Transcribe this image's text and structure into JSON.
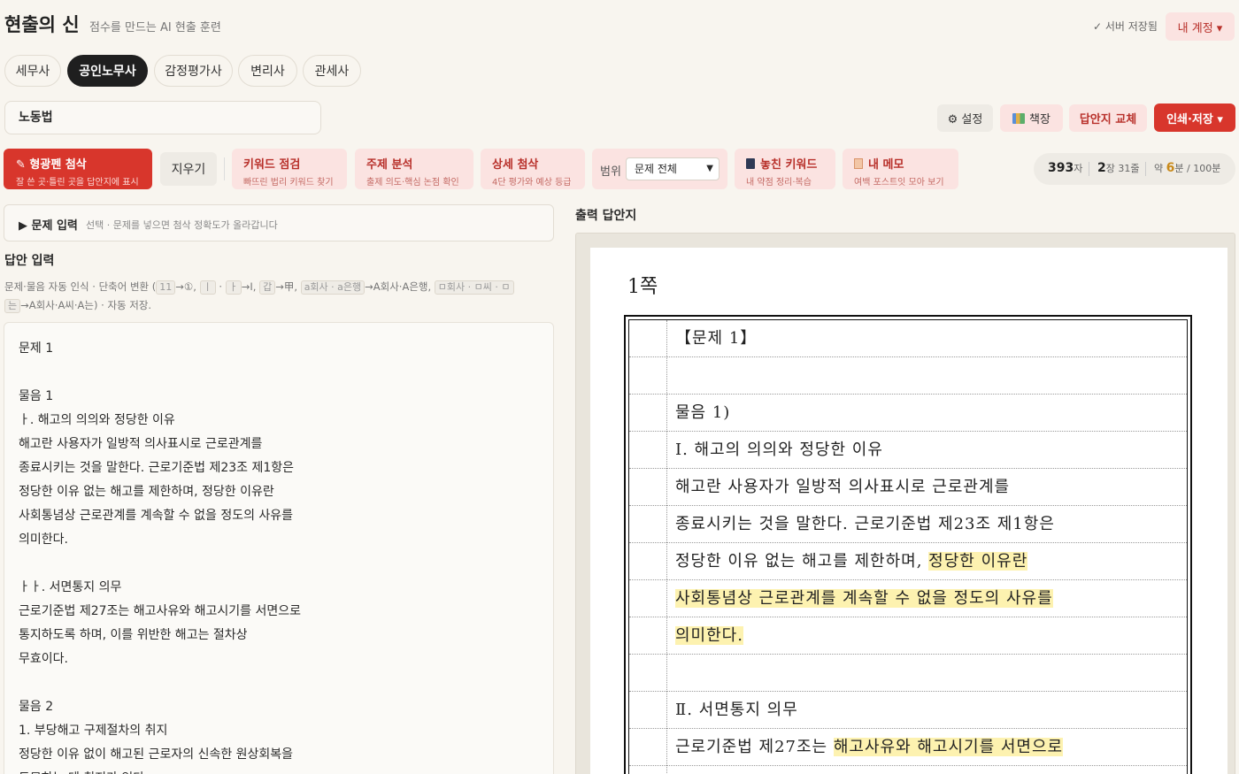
{
  "header": {
    "title": "현출의 신",
    "subtitle": "점수를 만드는 AI 현출 훈련",
    "saved": "✓ 서버 저장됨",
    "account": "내 계정 ▾"
  },
  "exam_tabs": [
    "세무사",
    "공인노무사",
    "감정평가사",
    "변리사",
    "관세사"
  ],
  "subject": {
    "value": "노동법"
  },
  "top_actions": {
    "settings": "⚙ 설정",
    "bookshelf": "책장",
    "swap_sheet": "답안지 교체",
    "print_save": "인쇄·저장 ▾"
  },
  "toolbar": {
    "highlighter": {
      "title": "✎ 형광펜 첨삭",
      "sub": "잘 쓴 곳·틀린 곳을 답안지에 표시"
    },
    "clear": "지우기",
    "keyword": {
      "title": "키워드 점검",
      "sub": "빠뜨린 법리 키워드 찾기"
    },
    "topic": {
      "title": "주제 분석",
      "sub": "출제 의도·핵심 논점 확인"
    },
    "detail": {
      "title": "상세 첨삭",
      "sub": "4단 평가와 예상 등급"
    },
    "range_label": "범위",
    "range_value": "문제 전체",
    "missed": {
      "title": "놓친 키워드",
      "sub": "내 약점 정리·복습"
    },
    "memo": {
      "title": "내 메모",
      "sub": "여백 포스트잇 모아 보기"
    }
  },
  "stats": {
    "chars": "393",
    "chars_unit": "자",
    "pages": "2",
    "pages_unit": "장 31줄",
    "time_prefix": "약 ",
    "minutes": "6",
    "time_suffix": "분 / 100분"
  },
  "question_panel": {
    "title": "▶ 문제 입력",
    "hint": "선택 · 문제를 넣으면 첨삭 정확도가 올라갑니다"
  },
  "answer_input": {
    "title": "답안 입력",
    "help_1": "문제·물음 자동 인식 · 단축어 변환 (",
    "help_k1": "11",
    "help_t1": "→①, ",
    "help_k2": "ㅣ",
    "help_k3": "ㅏ",
    "help_t2": "→Ⅰ, ",
    "help_k4": "갑",
    "help_t3": "→甲, ",
    "help_k5": "a회사 · a은행",
    "help_t4": "→A회사·A은행, ",
    "help_k6": "ㅁ회사 · ㅁ씨 · ㅁ",
    "help_k7": "는",
    "help_t5": "→A회사·A씨·A는) · 자동 저장.",
    "lines": [
      "문제 1",
      "",
      "물음 1",
      "ㅏ. 해고의 의의와 정당한 이유",
      "해고란 사용자가 일방적 의사표시로 근로관계를",
      "종료시키는 것을 말한다. 근로기준법 제23조 제1항은",
      "정당한 이유 없는 해고를 제한하며, 정당한 이유란",
      "사회통념상 근로관계를 계속할 수 없을 정도의 사유를",
      "의미한다.",
      "",
      "ㅏㅏ. 서면통지 의무",
      "근로기준법 제27조는 해고사유와 해고시기를 서면으로",
      "통지하도록 하며, 이를 위반한 해고는 절차상",
      "무효이다.",
      "",
      "물음 2",
      "1. 부당해고 구제절차의 취지",
      "정당한 이유 없이 해고된 근로자의 신속한 원상회복을",
      "도모하는 데 취지가 있다."
    ]
  },
  "output": {
    "title": "출력 답안지",
    "page_label": "1쪽",
    "rows": [
      {
        "plain": "【문제 1】"
      },
      {
        "plain": ""
      },
      {
        "plain": "물음 1)"
      },
      {
        "plain": "Ⅰ. 해고의 의의와 정당한 이유"
      },
      {
        "plain": "해고란 사용자가 일방적 의사표시로 근로관계를"
      },
      {
        "plain": "종료시키는 것을 말한다. 근로기준법 제23조 제1항은"
      },
      {
        "plain": "정당한 이유 없는 해고를 제한하며, ",
        "hl": "정당한 이유란"
      },
      {
        "plain": "",
        "hl": "사회통념상 근로관계를 계속할 수 없을 정도의 사유를"
      },
      {
        "plain": "",
        "hl": "의미한다."
      },
      {
        "plain": ""
      },
      {
        "plain": "Ⅱ. 서면통지 의무"
      },
      {
        "plain": "근로기준법 제27조는 ",
        "hl": "해고사유와 해고시기를 서면으로"
      }
    ]
  },
  "colors": {
    "accent": "#d8362c",
    "accent_soft": "#fbe3e1",
    "highlight": "#fdf2b0",
    "bg": "#f8f5ef"
  }
}
